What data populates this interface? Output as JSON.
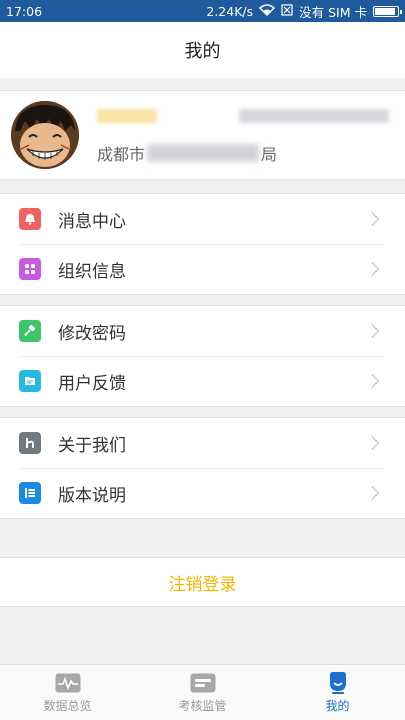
{
  "status_bar": {
    "time": "17:06",
    "speed": "2.24K/s",
    "sim": "没有 SIM 卡",
    "battery_level": 0.9
  },
  "header": {
    "title": "我的"
  },
  "profile": {
    "org_prefix": "成都市",
    "org_suffix": "局"
  },
  "menu_groups": [
    [
      {
        "label": "消息中心",
        "icon": "bell-icon",
        "color": "#f06262"
      },
      {
        "label": "组织信息",
        "icon": "grid-icon",
        "color": "#c65be0"
      }
    ],
    [
      {
        "label": "修改密码",
        "icon": "hammer-icon",
        "color": "#3cc56a"
      },
      {
        "label": "用户反馈",
        "icon": "feedback-icon",
        "color": "#28b8e6"
      }
    ],
    [
      {
        "label": "关于我们",
        "icon": "h-icon",
        "color": "#6f7a80"
      },
      {
        "label": "版本说明",
        "icon": "list-icon",
        "color": "#1a8be0"
      }
    ]
  ],
  "logout": {
    "label": "注销登录",
    "color": "#f4b400"
  },
  "tabs": [
    {
      "label": "数据总览",
      "icon": "pulse-icon"
    },
    {
      "label": "考核监管",
      "icon": "card-icon"
    },
    {
      "label": "我的",
      "icon": "person-icon",
      "active": true
    }
  ]
}
